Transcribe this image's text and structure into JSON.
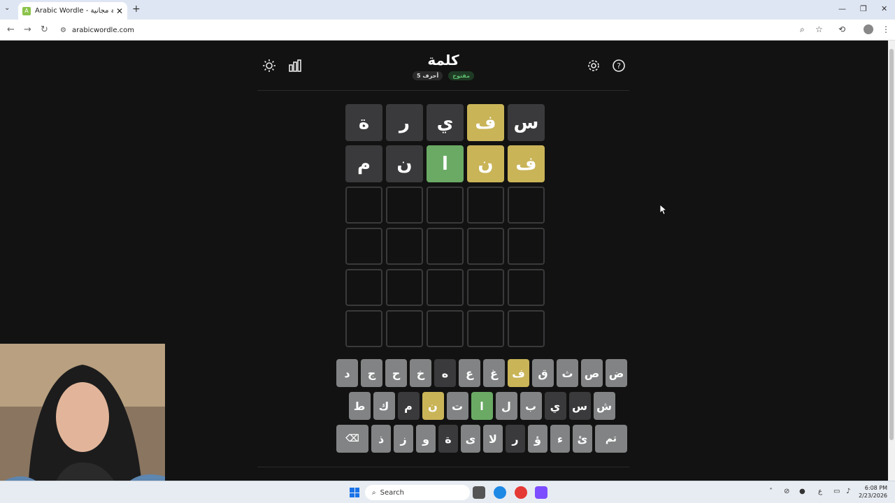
{
  "browser": {
    "tab_title": "Arabic Wordle - لعبة كلمات عربية مجانية",
    "url": "arabicwordle.com",
    "favicon_letter": "A"
  },
  "game": {
    "title": "كلمة",
    "badge_open": "مفتوح",
    "badge_letters": "5 أحرف",
    "icons": {
      "theme": "sun-icon",
      "stats": "bar-chart-icon",
      "settings": "gear-icon",
      "help": "question-circle-icon"
    },
    "rows": [
      [
        {
          "letter": "س",
          "state": "absent"
        },
        {
          "letter": "ف",
          "state": "present"
        },
        {
          "letter": "ي",
          "state": "absent"
        },
        {
          "letter": "ر",
          "state": "absent"
        },
        {
          "letter": "ة",
          "state": "absent"
        }
      ],
      [
        {
          "letter": "ف",
          "state": "present"
        },
        {
          "letter": "ن",
          "state": "present"
        },
        {
          "letter": "ا",
          "state": "correct"
        },
        {
          "letter": "ن",
          "state": "absent"
        },
        {
          "letter": "م",
          "state": "absent"
        }
      ],
      [
        {
          "letter": "",
          "state": "empty"
        },
        {
          "letter": "",
          "state": "empty"
        },
        {
          "letter": "",
          "state": "empty"
        },
        {
          "letter": "",
          "state": "empty"
        },
        {
          "letter": "",
          "state": "empty"
        }
      ],
      [
        {
          "letter": "",
          "state": "empty"
        },
        {
          "letter": "",
          "state": "empty"
        },
        {
          "letter": "",
          "state": "empty"
        },
        {
          "letter": "",
          "state": "empty"
        },
        {
          "letter": "",
          "state": "empty"
        }
      ],
      [
        {
          "letter": "",
          "state": "empty"
        },
        {
          "letter": "",
          "state": "empty"
        },
        {
          "letter": "",
          "state": "empty"
        },
        {
          "letter": "",
          "state": "empty"
        },
        {
          "letter": "",
          "state": "empty"
        }
      ],
      [
        {
          "letter": "",
          "state": "empty"
        },
        {
          "letter": "",
          "state": "empty"
        },
        {
          "letter": "",
          "state": "empty"
        },
        {
          "letter": "",
          "state": "empty"
        },
        {
          "letter": "",
          "state": "empty"
        }
      ]
    ],
    "keyboard": [
      [
        {
          "label": "ض",
          "state": "unused"
        },
        {
          "label": "ص",
          "state": "unused"
        },
        {
          "label": "ث",
          "state": "unused"
        },
        {
          "label": "ق",
          "state": "unused"
        },
        {
          "label": "ف",
          "state": "present"
        },
        {
          "label": "غ",
          "state": "unused"
        },
        {
          "label": "ع",
          "state": "unused"
        },
        {
          "label": "ه",
          "state": "absent"
        },
        {
          "label": "خ",
          "state": "unused"
        },
        {
          "label": "ح",
          "state": "unused"
        },
        {
          "label": "ج",
          "state": "unused"
        },
        {
          "label": "د",
          "state": "unused"
        }
      ],
      [
        {
          "label": "ش",
          "state": "unused"
        },
        {
          "label": "س",
          "state": "absent"
        },
        {
          "label": "ي",
          "state": "absent"
        },
        {
          "label": "ب",
          "state": "unused"
        },
        {
          "label": "ل",
          "state": "unused"
        },
        {
          "label": "ا",
          "state": "correct"
        },
        {
          "label": "ت",
          "state": "unused"
        },
        {
          "label": "ن",
          "state": "present"
        },
        {
          "label": "م",
          "state": "absent"
        },
        {
          "label": "ك",
          "state": "unused"
        },
        {
          "label": "ط",
          "state": "unused"
        }
      ],
      [
        {
          "label": "تم",
          "state": "unused",
          "wide": true
        },
        {
          "label": "ئ",
          "state": "unused"
        },
        {
          "label": "ء",
          "state": "unused"
        },
        {
          "label": "ؤ",
          "state": "unused"
        },
        {
          "label": "ر",
          "state": "absent"
        },
        {
          "label": "لا",
          "state": "unused"
        },
        {
          "label": "ى",
          "state": "unused"
        },
        {
          "label": "ة",
          "state": "absent"
        },
        {
          "label": "و",
          "state": "unused"
        },
        {
          "label": "ز",
          "state": "unused"
        },
        {
          "label": "ذ",
          "state": "unused"
        },
        {
          "label": "⌫",
          "state": "unused",
          "wide": true,
          "icon": "backspace-icon"
        }
      ]
    ]
  },
  "taskbar": {
    "search_placeholder": "Search",
    "time": "6:08 PM",
    "date": "2/23/2026",
    "lang": "ع"
  }
}
